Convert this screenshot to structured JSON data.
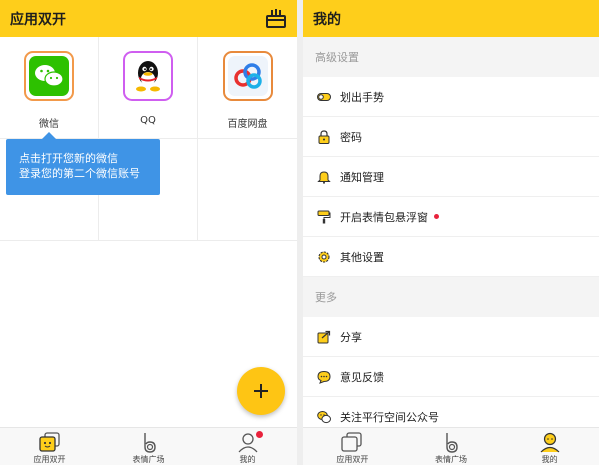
{
  "left_screen": {
    "header": {
      "title": "应用双开",
      "shop_icon": "shop-basket-icon"
    },
    "apps": [
      {
        "label": "微信",
        "icon": "wechat-icon",
        "border_color": "#f2994a"
      },
      {
        "label": "QQ",
        "icon": "qq-icon",
        "border_color": "#cf5ef0"
      },
      {
        "label": "百度网盘",
        "icon": "baidu-netdisk-icon",
        "border_color": "#e88a3c"
      }
    ],
    "tooltip": {
      "line1": "点击打开您新的微信",
      "line2": "登录您的第二个微信账号"
    },
    "fab": {
      "icon": "plus-icon"
    },
    "tabbar": [
      {
        "label": "应用双开",
        "icon": "dual-apps-icon",
        "badge": false
      },
      {
        "label": "表情广场",
        "icon": "emoji-square-icon",
        "badge": false
      },
      {
        "label": "我的",
        "icon": "profile-icon",
        "badge": true
      }
    ]
  },
  "right_screen": {
    "header": {
      "title": "我的"
    },
    "sections": [
      {
        "title": "高级设置",
        "items": [
          {
            "label": "划出手势",
            "icon": "gesture-toggle-icon",
            "badge": false
          },
          {
            "label": "密码",
            "icon": "lock-icon",
            "badge": false
          },
          {
            "label": "通知管理",
            "icon": "bell-icon",
            "badge": false
          },
          {
            "label": "开启表情包悬浮窗",
            "icon": "paint-roller-icon",
            "badge": true
          },
          {
            "label": "其他设置",
            "icon": "gear-icon",
            "badge": false
          }
        ]
      },
      {
        "title": "更多",
        "items": [
          {
            "label": "分享",
            "icon": "share-icon",
            "badge": false
          },
          {
            "label": "意见反馈",
            "icon": "feedback-chat-icon",
            "badge": false
          },
          {
            "label": "关注平行空间公众号",
            "icon": "wechat-follow-icon",
            "badge": false
          }
        ]
      }
    ],
    "tabbar": [
      {
        "label": "应用双开",
        "icon": "dual-apps-icon"
      },
      {
        "label": "表情广场",
        "icon": "emoji-square-icon"
      },
      {
        "label": "我的",
        "icon": "profile-icon"
      }
    ]
  },
  "colors": {
    "brand_yellow": "#fece1b",
    "tooltip_blue": "#3f94e6",
    "badge_red": "#e8223c"
  }
}
